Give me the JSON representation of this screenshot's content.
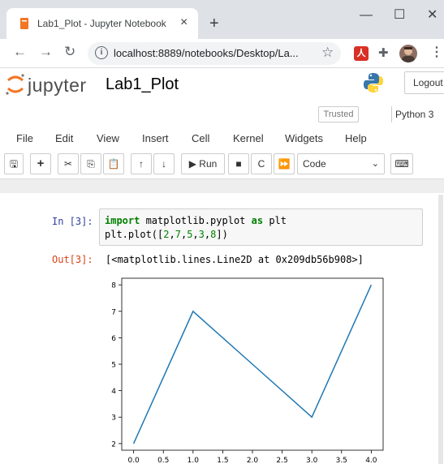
{
  "browser": {
    "tab_title": "Lab1_Plot - Jupyter Notebook",
    "tab_close": "×",
    "new_tab": "+",
    "win_min": "—",
    "win_max": "☐",
    "win_close": "✕",
    "url": "localhost:8889/notebooks/Desktop/La...",
    "pdf_ext": "人"
  },
  "jupyter": {
    "wordmark": "jupyter",
    "notebook_name": "Lab1_Plot",
    "logout_label": "Logout",
    "trusted_label": "Trusted",
    "kernel_label": "Python 3",
    "menus": [
      "File",
      "Edit",
      "View",
      "Insert",
      "Cell",
      "Kernel",
      "Widgets",
      "Help"
    ],
    "run_label": "Run",
    "cell_type": "Code"
  },
  "cell": {
    "in_prompt": "In [3]:",
    "out_prompt": "Out[3]:",
    "output_text": "[<matplotlib.lines.Line2D at 0x209db56b908>]"
  },
  "chart_data": {
    "type": "line",
    "x": [
      0,
      1,
      2,
      3,
      4
    ],
    "y": [
      2,
      7,
      5,
      3,
      8
    ],
    "xlim": [
      -0.2,
      4.2
    ],
    "ylim": [
      1.75,
      8.25
    ],
    "xticks": [
      0.0,
      0.5,
      1.0,
      1.5,
      2.0,
      2.5,
      3.0,
      3.5,
      4.0
    ],
    "xtick_labels": [
      "0.0",
      "0.5",
      "1.0",
      "1.5",
      "2.0",
      "2.5",
      "3.0",
      "3.5",
      "4.0"
    ],
    "yticks": [
      2,
      3,
      4,
      5,
      6,
      7,
      8
    ],
    "ytick_labels": [
      "2",
      "3",
      "4",
      "5",
      "6",
      "7",
      "8"
    ],
    "line_color": "#1f77b4",
    "grid": false
  },
  "colors": {
    "in_prompt": "#303F9F",
    "out_prompt": "#D84315",
    "keyword": "#008000"
  }
}
